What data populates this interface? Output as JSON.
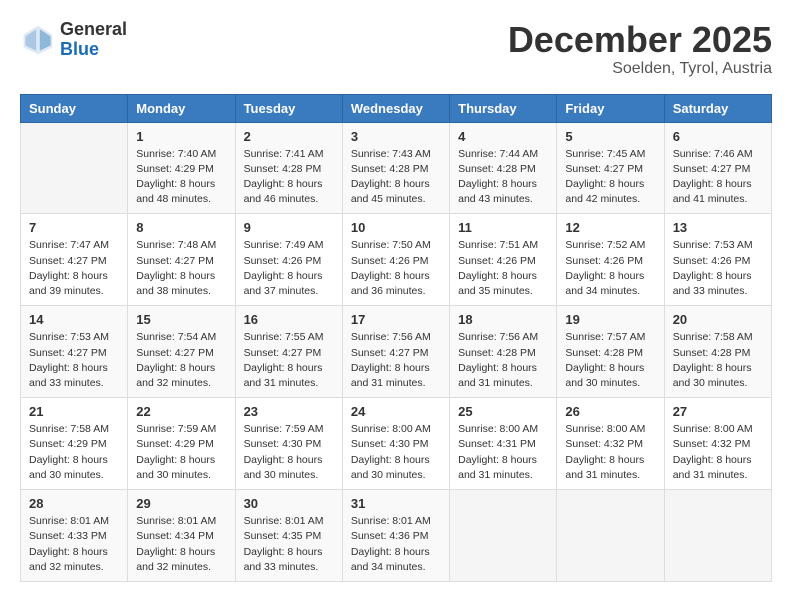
{
  "header": {
    "logo_general": "General",
    "logo_blue": "Blue",
    "month_title": "December 2025",
    "location": "Soelden, Tyrol, Austria"
  },
  "calendar": {
    "days_of_week": [
      "Sunday",
      "Monday",
      "Tuesday",
      "Wednesday",
      "Thursday",
      "Friday",
      "Saturday"
    ],
    "weeks": [
      [
        {
          "day": "",
          "info": ""
        },
        {
          "day": "1",
          "info": "Sunrise: 7:40 AM\nSunset: 4:29 PM\nDaylight: 8 hours\nand 48 minutes."
        },
        {
          "day": "2",
          "info": "Sunrise: 7:41 AM\nSunset: 4:28 PM\nDaylight: 8 hours\nand 46 minutes."
        },
        {
          "day": "3",
          "info": "Sunrise: 7:43 AM\nSunset: 4:28 PM\nDaylight: 8 hours\nand 45 minutes."
        },
        {
          "day": "4",
          "info": "Sunrise: 7:44 AM\nSunset: 4:28 PM\nDaylight: 8 hours\nand 43 minutes."
        },
        {
          "day": "5",
          "info": "Sunrise: 7:45 AM\nSunset: 4:27 PM\nDaylight: 8 hours\nand 42 minutes."
        },
        {
          "day": "6",
          "info": "Sunrise: 7:46 AM\nSunset: 4:27 PM\nDaylight: 8 hours\nand 41 minutes."
        }
      ],
      [
        {
          "day": "7",
          "info": "Sunrise: 7:47 AM\nSunset: 4:27 PM\nDaylight: 8 hours\nand 39 minutes."
        },
        {
          "day": "8",
          "info": "Sunrise: 7:48 AM\nSunset: 4:27 PM\nDaylight: 8 hours\nand 38 minutes."
        },
        {
          "day": "9",
          "info": "Sunrise: 7:49 AM\nSunset: 4:26 PM\nDaylight: 8 hours\nand 37 minutes."
        },
        {
          "day": "10",
          "info": "Sunrise: 7:50 AM\nSunset: 4:26 PM\nDaylight: 8 hours\nand 36 minutes."
        },
        {
          "day": "11",
          "info": "Sunrise: 7:51 AM\nSunset: 4:26 PM\nDaylight: 8 hours\nand 35 minutes."
        },
        {
          "day": "12",
          "info": "Sunrise: 7:52 AM\nSunset: 4:26 PM\nDaylight: 8 hours\nand 34 minutes."
        },
        {
          "day": "13",
          "info": "Sunrise: 7:53 AM\nSunset: 4:26 PM\nDaylight: 8 hours\nand 33 minutes."
        }
      ],
      [
        {
          "day": "14",
          "info": "Sunrise: 7:53 AM\nSunset: 4:27 PM\nDaylight: 8 hours\nand 33 minutes."
        },
        {
          "day": "15",
          "info": "Sunrise: 7:54 AM\nSunset: 4:27 PM\nDaylight: 8 hours\nand 32 minutes."
        },
        {
          "day": "16",
          "info": "Sunrise: 7:55 AM\nSunset: 4:27 PM\nDaylight: 8 hours\nand 31 minutes."
        },
        {
          "day": "17",
          "info": "Sunrise: 7:56 AM\nSunset: 4:27 PM\nDaylight: 8 hours\nand 31 minutes."
        },
        {
          "day": "18",
          "info": "Sunrise: 7:56 AM\nSunset: 4:28 PM\nDaylight: 8 hours\nand 31 minutes."
        },
        {
          "day": "19",
          "info": "Sunrise: 7:57 AM\nSunset: 4:28 PM\nDaylight: 8 hours\nand 30 minutes."
        },
        {
          "day": "20",
          "info": "Sunrise: 7:58 AM\nSunset: 4:28 PM\nDaylight: 8 hours\nand 30 minutes."
        }
      ],
      [
        {
          "day": "21",
          "info": "Sunrise: 7:58 AM\nSunset: 4:29 PM\nDaylight: 8 hours\nand 30 minutes."
        },
        {
          "day": "22",
          "info": "Sunrise: 7:59 AM\nSunset: 4:29 PM\nDaylight: 8 hours\nand 30 minutes."
        },
        {
          "day": "23",
          "info": "Sunrise: 7:59 AM\nSunset: 4:30 PM\nDaylight: 8 hours\nand 30 minutes."
        },
        {
          "day": "24",
          "info": "Sunrise: 8:00 AM\nSunset: 4:30 PM\nDaylight: 8 hours\nand 30 minutes."
        },
        {
          "day": "25",
          "info": "Sunrise: 8:00 AM\nSunset: 4:31 PM\nDaylight: 8 hours\nand 31 minutes."
        },
        {
          "day": "26",
          "info": "Sunrise: 8:00 AM\nSunset: 4:32 PM\nDaylight: 8 hours\nand 31 minutes."
        },
        {
          "day": "27",
          "info": "Sunrise: 8:00 AM\nSunset: 4:32 PM\nDaylight: 8 hours\nand 31 minutes."
        }
      ],
      [
        {
          "day": "28",
          "info": "Sunrise: 8:01 AM\nSunset: 4:33 PM\nDaylight: 8 hours\nand 32 minutes."
        },
        {
          "day": "29",
          "info": "Sunrise: 8:01 AM\nSunset: 4:34 PM\nDaylight: 8 hours\nand 32 minutes."
        },
        {
          "day": "30",
          "info": "Sunrise: 8:01 AM\nSunset: 4:35 PM\nDaylight: 8 hours\nand 33 minutes."
        },
        {
          "day": "31",
          "info": "Sunrise: 8:01 AM\nSunset: 4:36 PM\nDaylight: 8 hours\nand 34 minutes."
        },
        {
          "day": "",
          "info": ""
        },
        {
          "day": "",
          "info": ""
        },
        {
          "day": "",
          "info": ""
        }
      ]
    ]
  }
}
